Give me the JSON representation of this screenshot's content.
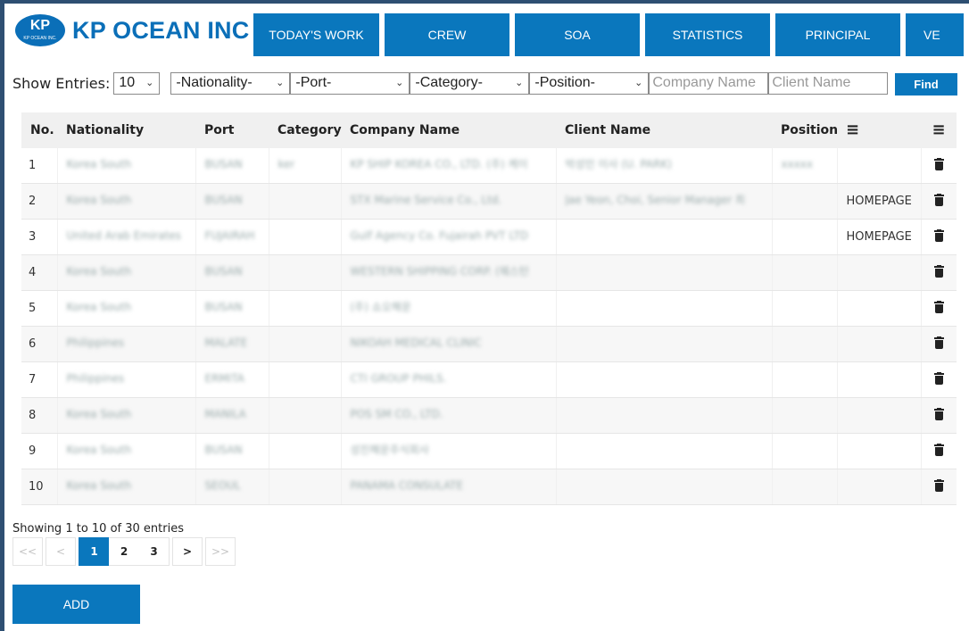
{
  "brand": {
    "badge": "KP",
    "badge_sub": "KP OCEAN INC.",
    "name": "KP OCEAN INC"
  },
  "nav": [
    "TODAY'S WORK",
    "CREW",
    "SOA",
    "STATISTICS",
    "PRINCIPAL",
    "VE"
  ],
  "filters": {
    "show_label": "Show Entries:",
    "entries": "10",
    "nationality": "-Nationality-",
    "port": "-Port-",
    "category": "-Category-",
    "position": "-Position-",
    "company_placeholder": "Company Name",
    "client_placeholder": "Client Name",
    "find": "Find"
  },
  "table": {
    "headers": {
      "no": "No.",
      "nationality": "Nationality",
      "port": "Port",
      "category": "Category",
      "company": "Company Name",
      "client": "Client Name",
      "position": "Position"
    },
    "rows": [
      {
        "no": "1",
        "nationality": "Korea South",
        "port": "BUSAN",
        "category": "ker",
        "company": "KP SHIP KOREA CO., LTD. (주) 케이",
        "client": "박성민 이사 (U. PARK)",
        "position": "xxxxx",
        "link": ""
      },
      {
        "no": "2",
        "nationality": "Korea South",
        "port": "BUSAN",
        "category": "",
        "company": "STX Marine Service Co., Ltd.",
        "client": "Jae Yeon, Choi, Senior Manager 최",
        "position": "",
        "link": "HOMEPAGE"
      },
      {
        "no": "3",
        "nationality": "United Arab Emirates",
        "port": "FUJAIRAH",
        "category": "",
        "company": "Gulf Agency Co. Fujairah PVT LTD",
        "client": "",
        "position": "",
        "link": "HOMEPAGE"
      },
      {
        "no": "4",
        "nationality": "Korea South",
        "port": "BUSAN",
        "category": "",
        "company": "WESTERN SHIPPING CORP. (웨스턴",
        "client": "",
        "position": "",
        "link": ""
      },
      {
        "no": "5",
        "nationality": "Korea South",
        "port": "BUSAN",
        "category": "",
        "company": "(주) 쇼오해운",
        "client": "",
        "position": "",
        "link": ""
      },
      {
        "no": "6",
        "nationality": "Philippines",
        "port": "MALATE",
        "category": "",
        "company": "NIKOAH MEDICAL CLINIC",
        "client": "",
        "position": "",
        "link": ""
      },
      {
        "no": "7",
        "nationality": "Philippines",
        "port": "ERMITA",
        "category": "",
        "company": "CTI GROUP PHILS.",
        "client": "",
        "position": "",
        "link": ""
      },
      {
        "no": "8",
        "nationality": "Korea South",
        "port": "MANILA",
        "category": "",
        "company": "POS SM CO., LTD.",
        "client": "",
        "position": "",
        "link": ""
      },
      {
        "no": "9",
        "nationality": "Korea South",
        "port": "BUSAN",
        "category": "",
        "company": "성진해운주식회사",
        "client": "",
        "position": "",
        "link": ""
      },
      {
        "no": "10",
        "nationality": "Korea South",
        "port": "SEOUL",
        "category": "",
        "company": "PANAMA CONSULATE",
        "client": "",
        "position": "",
        "link": ""
      }
    ]
  },
  "footer": {
    "showing": "Showing 1 to 10 of 30 entries",
    "pager": {
      "first": "<<",
      "prev": "<",
      "pages": [
        "1",
        "2",
        "3"
      ],
      "next": ">",
      "last": ">>"
    },
    "add": "ADD"
  },
  "colors": {
    "accent": "#0a77bd",
    "brand_text": "#0b6fb8",
    "frame": "#2e4f72"
  }
}
